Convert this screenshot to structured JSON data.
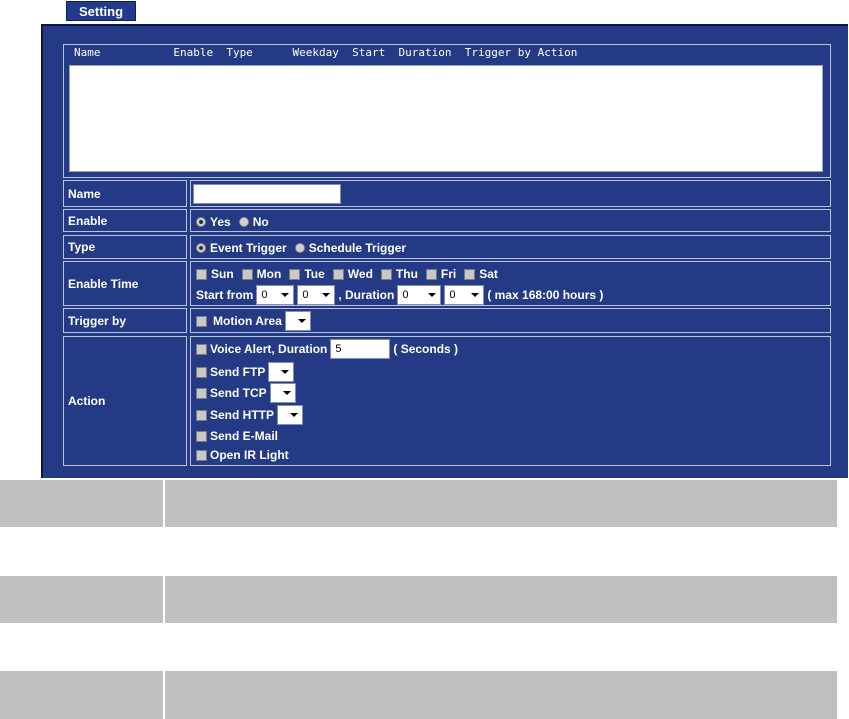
{
  "setting_label": "Setting",
  "list_header": "Name           Enable  Type      Weekday  Start  Duration  Trigger by Action",
  "form": {
    "name": {
      "label": "Name",
      "value": ""
    },
    "enable": {
      "label": "Enable",
      "yes": "Yes",
      "no": "No",
      "selected": "Yes"
    },
    "type": {
      "label": "Type",
      "event": "Event Trigger",
      "schedule": "Schedule Trigger",
      "selected": "Event Trigger"
    },
    "enable_time": {
      "label": "Enable Time",
      "days": [
        "Sun",
        "Mon",
        "Tue",
        "Wed",
        "Thu",
        "Fri",
        "Sat"
      ],
      "start_from_label": "Start from",
      "start_hour": "0",
      "start_min": "0",
      "duration_label": ", Duration",
      "duration_hour": "0",
      "duration_min": "0",
      "max_note": "( max 168:00 hours )"
    },
    "trigger_by": {
      "label": "Trigger by",
      "motion_area": "Motion Area"
    },
    "action": {
      "label": "Action",
      "voice_alert": "Voice Alert, Duration",
      "voice_value": "5",
      "seconds": "( Seconds )",
      "send_ftp": "Send FTP",
      "send_tcp": "Send TCP",
      "send_http": "Send HTTP",
      "send_email": "Send E-Mail",
      "open_ir": "Open IR Light"
    }
  }
}
